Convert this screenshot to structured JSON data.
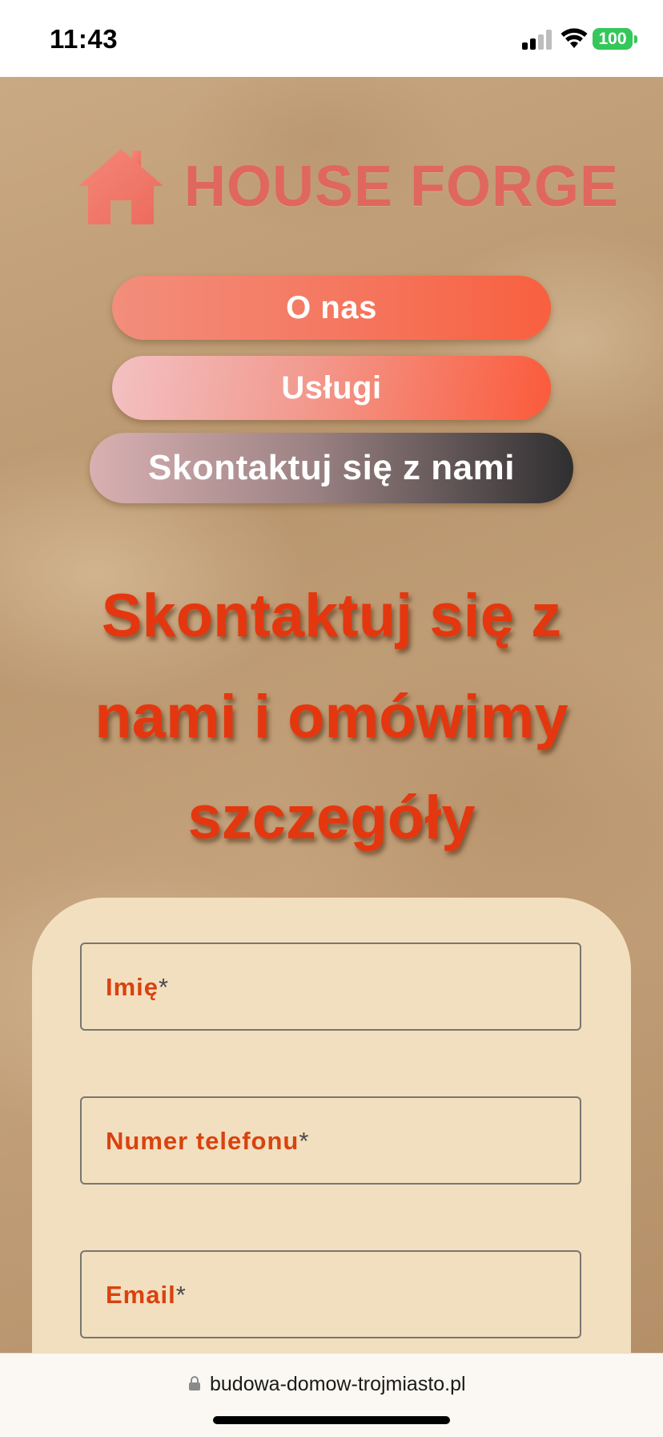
{
  "status_bar": {
    "time": "11:43",
    "battery": "100",
    "icons": [
      "signal-icon",
      "wifi-icon",
      "battery-icon"
    ]
  },
  "brand": {
    "name": "HOUSE FORGE",
    "logo_icon": "house-icon",
    "color": "#e0675b"
  },
  "nav": {
    "items": [
      {
        "label": "O nas"
      },
      {
        "label": "Usługi"
      },
      {
        "label": "Skontaktuj się z nami"
      }
    ]
  },
  "main": {
    "headline": "Skontaktuj się z nami i omówimy szczegóły"
  },
  "form": {
    "fields": [
      {
        "label": "Imię",
        "required_mark": "*"
      },
      {
        "label": "Numer telefonu",
        "required_mark": "*"
      },
      {
        "label": "Email",
        "required_mark": "*"
      }
    ]
  },
  "browser": {
    "url": "budowa-domow-trojmiasto.pl",
    "lock_icon": "lock-icon"
  },
  "colors": {
    "accent_red": "#e4370f",
    "label_red": "#d9420f",
    "form_bg": "#f2dfbf",
    "battery_green": "#34c759"
  }
}
